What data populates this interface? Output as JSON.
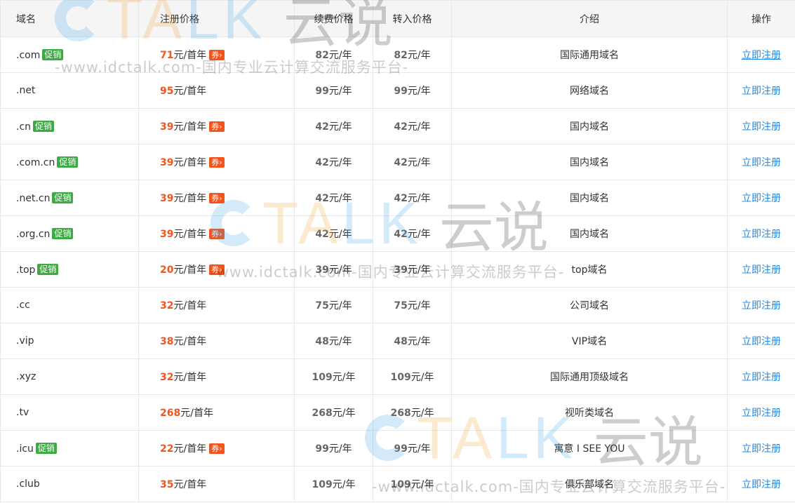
{
  "headers": [
    "域名",
    "注册价格",
    "续费价格",
    "转入价格",
    "介绍",
    "操作"
  ],
  "promo_label": "促销",
  "coupon_label": "券›",
  "reg_unit": "元/首年",
  "year_unit": "元/年",
  "action_label": "立即注册",
  "watermark": {
    "letters_a": "TA",
    "letters_b": "LK",
    "chinese": "云说",
    "line": "-www.idctalk.com-国内专业云计算交流服务平台-"
  },
  "rows": [
    {
      "domain": ".com",
      "promo": true,
      "reg": "71",
      "coupon": true,
      "renew": "82",
      "transfer": "82",
      "intro": "国际通用域名"
    },
    {
      "domain": ".net",
      "promo": false,
      "reg": "95",
      "coupon": false,
      "renew": "99",
      "transfer": "99",
      "intro": "网络域名"
    },
    {
      "domain": ".cn",
      "promo": true,
      "reg": "39",
      "coupon": true,
      "renew": "42",
      "transfer": "42",
      "intro": "国内域名"
    },
    {
      "domain": ".com.cn",
      "promo": true,
      "reg": "39",
      "coupon": true,
      "renew": "42",
      "transfer": "42",
      "intro": "国内域名"
    },
    {
      "domain": ".net.cn",
      "promo": true,
      "reg": "39",
      "coupon": true,
      "renew": "42",
      "transfer": "42",
      "intro": "国内域名"
    },
    {
      "domain": ".org.cn",
      "promo": true,
      "reg": "39",
      "coupon": true,
      "renew": "42",
      "transfer": "42",
      "intro": "国内域名"
    },
    {
      "domain": ".top",
      "promo": true,
      "reg": "20",
      "coupon": true,
      "renew": "39",
      "transfer": "39",
      "intro": "top域名"
    },
    {
      "domain": ".cc",
      "promo": false,
      "reg": "32",
      "coupon": false,
      "renew": "75",
      "transfer": "75",
      "intro": "公司域名"
    },
    {
      "domain": ".vip",
      "promo": false,
      "reg": "38",
      "coupon": false,
      "renew": "48",
      "transfer": "48",
      "intro": "VIP域名"
    },
    {
      "domain": ".xyz",
      "promo": false,
      "reg": "32",
      "coupon": false,
      "renew": "109",
      "transfer": "109",
      "intro": "国际通用顶级域名"
    },
    {
      "domain": ".tv",
      "promo": false,
      "reg": "268",
      "coupon": false,
      "renew": "268",
      "transfer": "268",
      "intro": "视听类域名"
    },
    {
      "domain": ".icu",
      "promo": true,
      "reg": "22",
      "coupon": true,
      "renew": "99",
      "transfer": "99",
      "intro": "寓意 I SEE YOU"
    },
    {
      "domain": ".club",
      "promo": false,
      "reg": "35",
      "coupon": false,
      "renew": "109",
      "transfer": "109",
      "intro": "俱乐部域名"
    }
  ]
}
